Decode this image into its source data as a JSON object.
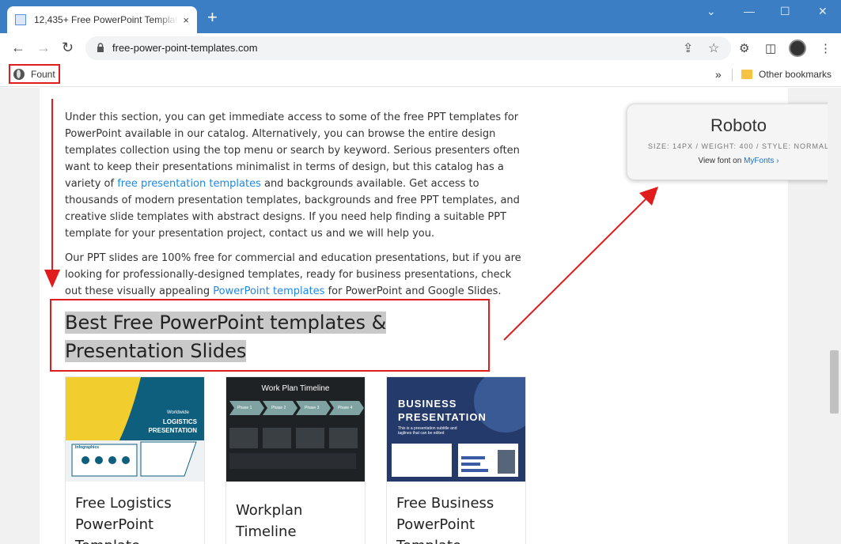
{
  "browser": {
    "tab_title": "12,435+ Free PowerPoint Templates",
    "tab_close": "×",
    "new_tab": "+",
    "url": "free-power-point-templates.com",
    "window_controls": {
      "minimize": "—",
      "maximize": "☐",
      "close": "✕",
      "tab_search": "⌄"
    }
  },
  "bookmarks": {
    "fount_label": "Fount",
    "more": "»",
    "other_label": "Other bookmarks"
  },
  "page": {
    "para1_a": "Under this section, you can get immediate access to some of the free PPT templates for PowerPoint available in our catalog. Alternatively, you can browse the entire design templates collection using the top menu or search by keyword. Serious presenters often want to keep their presentations minimalist in terms of design, but this catalog has a variety of ",
    "para1_link": "free presentation templates",
    "para1_b": " and backgrounds available. Get access to thousands of modern presentation templates, backgrounds and free PPT templates, and creative slide templates with abstract designs. If you need help finding a suitable PPT template for your presentation project, contact us and we will help you.",
    "para2_a": "Our PPT slides are 100% free for commercial and education presentations, but if you are looking for professionally-designed templates, ready for business presentations, check out these visually appealing ",
    "para2_link": "PowerPoint templates",
    "para2_b": " for PowerPoint and Google Slides.",
    "heading": "Best Free PowerPoint templates & Presentation Slides",
    "cards": [
      {
        "title": "Free Logistics PowerPoint Template",
        "thumb_heading": "LOGISTICS PRESENTATION",
        "thumb_sub": "Worldwide",
        "thumb_small": "Infographics"
      },
      {
        "title": "Workplan Timeline Template for",
        "thumb_heading": "Work Plan Timeline",
        "phases": [
          "Phase 1",
          "Phase 2",
          "Phase 3",
          "Phase 4"
        ]
      },
      {
        "title": "Free Business PowerPoint Template",
        "thumb_heading": "BUSINESS PRESENTATION",
        "thumb_sub": "This is a presentation subtitle and taglines that can be edited"
      }
    ]
  },
  "font_popup": {
    "name": "Roboto",
    "meta": "SIZE: 14PX / WEIGHT: 400 / STYLE: NORMAL",
    "link_prefix": "View font on ",
    "link_text": "MyFonts ›"
  },
  "colors": {
    "titlebar": "#3c7ec4",
    "annotation_red": "#e01c1c",
    "link_blue": "#1e88e5"
  }
}
